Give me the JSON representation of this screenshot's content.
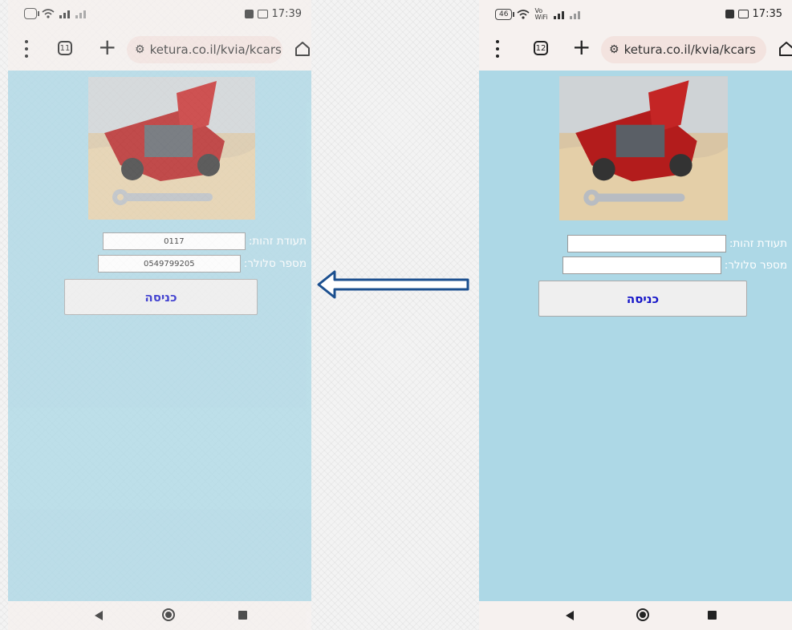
{
  "left": {
    "status_time": "17:39",
    "tab_count": "11",
    "url": "ketura.co.il/kvia/kcars",
    "id_label": "תעודת זהות:",
    "id_value": "0117",
    "phone_label": "מספר סלולר:",
    "phone_value": "0549799205",
    "submit_label": "כניסה"
  },
  "right": {
    "status_time": "17:35",
    "battery": "46",
    "signal_text": "Vo WiFi",
    "tab_count": "12",
    "url": "ketura.co.il/kvia/kcars",
    "id_label": "תעודת זהות:",
    "id_value": "",
    "phone_label": "מספר סלולר:",
    "phone_value": "",
    "submit_label": "כניסה"
  },
  "colors": {
    "page_bg": "#add8e6",
    "browser_chrome": "#f6f1ef",
    "url_pill": "#f3e3df",
    "button_text": "#1414c8",
    "arrow": "#1b4f8f"
  },
  "icons": [
    "wifi-icon",
    "signal-icon",
    "tabs-icon",
    "plus-icon",
    "site-settings-icon",
    "home-icon",
    "back-icon",
    "recents-icon"
  ]
}
